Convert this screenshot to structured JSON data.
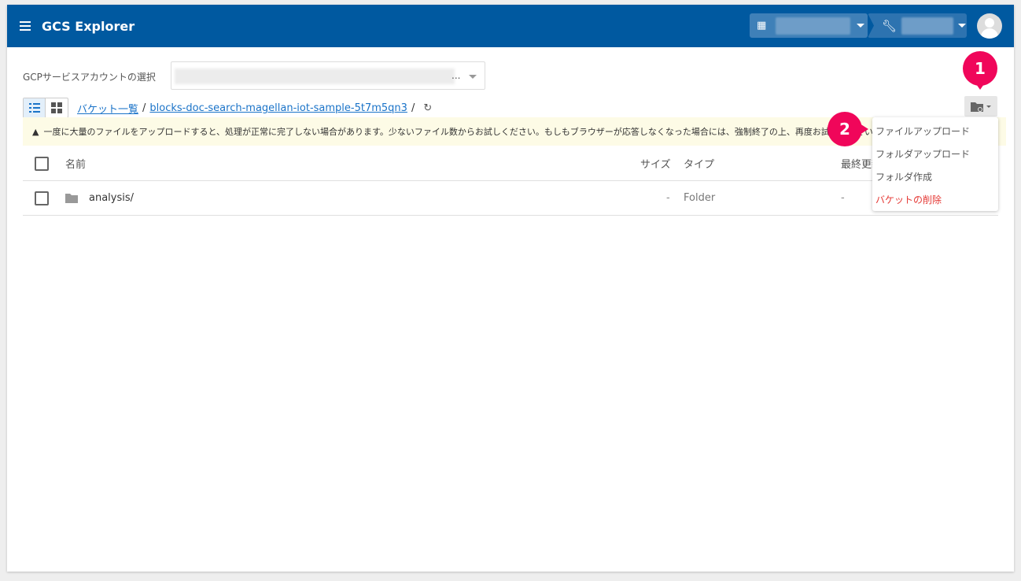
{
  "header": {
    "title": "GCS Explorer"
  },
  "account": {
    "label": "GCPサービスアカウントの選択",
    "value_suffix": "..."
  },
  "breadcrumb": {
    "root": "バケット一覧",
    "separator": "/",
    "bucket": "blocks-doc-search-magellan-iot-sample-5t7m5qn3"
  },
  "warning": "一度に大量のファイルをアップロードすると、処理が正常に完了しない場合があります。少ないファイル数からお試しください。もしもブラウザーが応答しなくなった場合には、強制終了の上、再度お試しください。",
  "table": {
    "columns": [
      "名前",
      "サイズ",
      "タイプ",
      "最終更新"
    ],
    "rows": [
      {
        "name": "analysis/",
        "size": "-",
        "type": "Folder",
        "modified": "-"
      }
    ]
  },
  "menu": {
    "items": [
      "ファイルアップロード",
      "フォルダアップロード",
      "フォルダ作成",
      "バケットの削除"
    ]
  },
  "markers": [
    "1",
    "2"
  ],
  "colors": {
    "header": "#0059a0",
    "marker": "#f0065a",
    "danger": "#e53935",
    "link": "#1a73c8"
  }
}
